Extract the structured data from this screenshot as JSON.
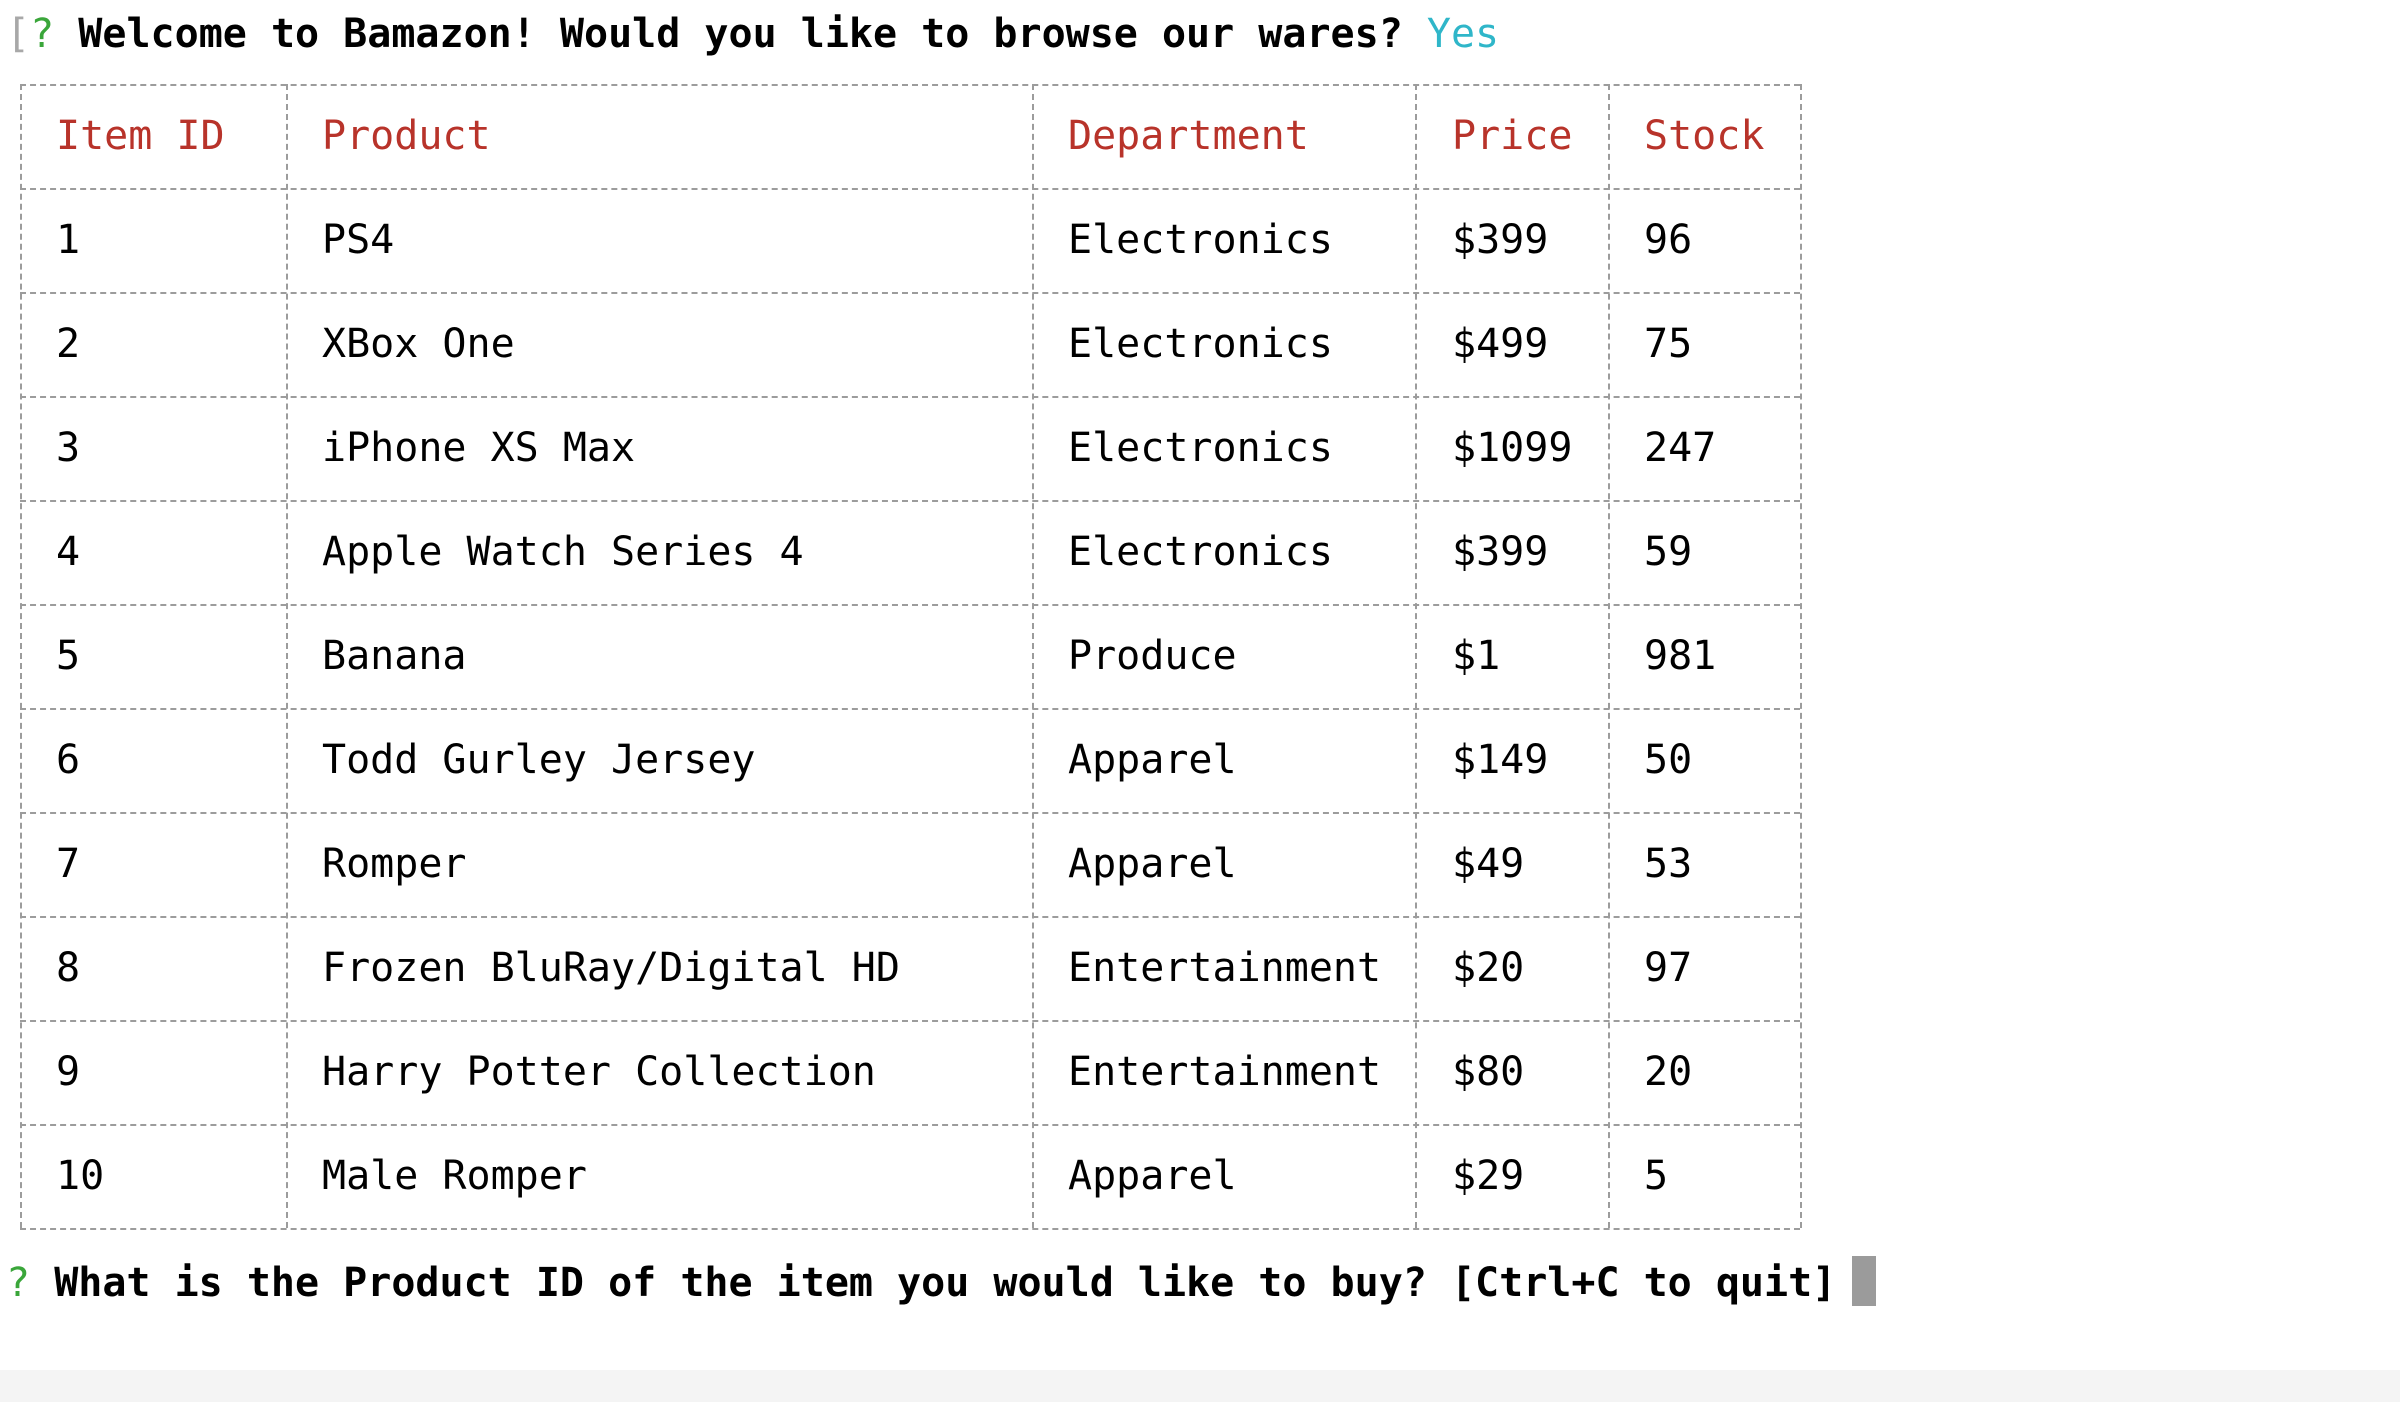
{
  "prompt1": {
    "bracket": "[",
    "qmark": "?",
    "question": "Welcome to Bamazon! Would you like to browse our wares?",
    "answer": "Yes"
  },
  "table": {
    "headers": [
      "Item ID",
      "Product",
      "Department",
      "Price",
      "Stock"
    ],
    "rows": [
      [
        "1",
        "PS4",
        "Electronics",
        "$399",
        "96"
      ],
      [
        "2",
        "XBox One",
        "Electronics",
        "$499",
        "75"
      ],
      [
        "3",
        "iPhone XS Max",
        "Electronics",
        "$1099",
        "247"
      ],
      [
        "4",
        "Apple Watch Series 4",
        "Electronics",
        "$399",
        "59"
      ],
      [
        "5",
        "Banana",
        "Produce",
        "$1",
        "981"
      ],
      [
        "6",
        "Todd Gurley Jersey",
        "Apparel",
        "$149",
        "50"
      ],
      [
        "7",
        "Romper",
        "Apparel",
        "$49",
        "53"
      ],
      [
        "8",
        "Frozen BluRay/Digital HD",
        "Entertainment",
        "$20",
        "97"
      ],
      [
        "9",
        "Harry Potter Collection",
        "Entertainment",
        "$80",
        "20"
      ],
      [
        "10",
        "Male Romper",
        "Apparel",
        "$29",
        "5"
      ]
    ]
  },
  "prompt2": {
    "qmark": "?",
    "question": "What is the Product ID of the item you would like to buy? [Ctrl+C to quit]"
  },
  "colors": {
    "header_text": "#b8332a",
    "answer": "#2fb6c9",
    "qmark": "#3aa63a",
    "cursor": "#9b9b9b"
  }
}
